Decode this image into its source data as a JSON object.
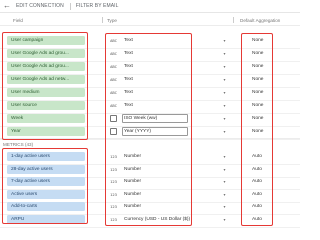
{
  "topbar": {
    "edit_connection": "EDIT CONNECTION",
    "filter_by_email": "FILTER BY EMAIL"
  },
  "headers": {
    "field": "Field",
    "type": "Type",
    "aggregation": "Default Aggregation"
  },
  "metrics_section_label": "METRICS (43)",
  "dimensions": [
    {
      "name": "User campaign",
      "type_icon": "ABC",
      "type": "Text",
      "aggregation": "None"
    },
    {
      "name": "User Google Ads ad grou...",
      "type_icon": "ABC",
      "type": "Text",
      "aggregation": "None"
    },
    {
      "name": "User Google Ads ad grou...",
      "type_icon": "ABC",
      "type": "Text",
      "aggregation": "None"
    },
    {
      "name": "User Google Ads ad netw...",
      "type_icon": "ABC",
      "type": "Text",
      "aggregation": "None"
    },
    {
      "name": "User medium",
      "type_icon": "ABC",
      "type": "Text",
      "aggregation": "None"
    },
    {
      "name": "User source",
      "type_icon": "ABC",
      "type": "Text",
      "aggregation": "None"
    },
    {
      "name": "Week",
      "type_icon": "calendar",
      "type": "ISO Week (ww)",
      "aggregation": "None"
    },
    {
      "name": "Year",
      "type_icon": "calendar",
      "type": "Year (YYYY)",
      "aggregation": "None"
    }
  ],
  "metrics": [
    {
      "name": "1-day active users",
      "type_icon": "123",
      "type": "Number",
      "aggregation": "Auto"
    },
    {
      "name": "28-day active users",
      "type_icon": "123",
      "type": "Number",
      "aggregation": "Auto"
    },
    {
      "name": "7-day active users",
      "type_icon": "123",
      "type": "Number",
      "aggregation": "Auto"
    },
    {
      "name": "Active users",
      "type_icon": "123",
      "type": "Number",
      "aggregation": "Auto"
    },
    {
      "name": "Add-to-carts",
      "type_icon": "123",
      "type": "Number",
      "aggregation": "Auto"
    },
    {
      "name": "ARPU",
      "type_icon": "123",
      "type": "Currency (USD - US Dollar ($))",
      "aggregation": "Auto"
    }
  ],
  "colors": {
    "highlight": "#e53935",
    "dimension_chip": "#c8e6c9",
    "metric_chip": "#c5dcf3"
  }
}
